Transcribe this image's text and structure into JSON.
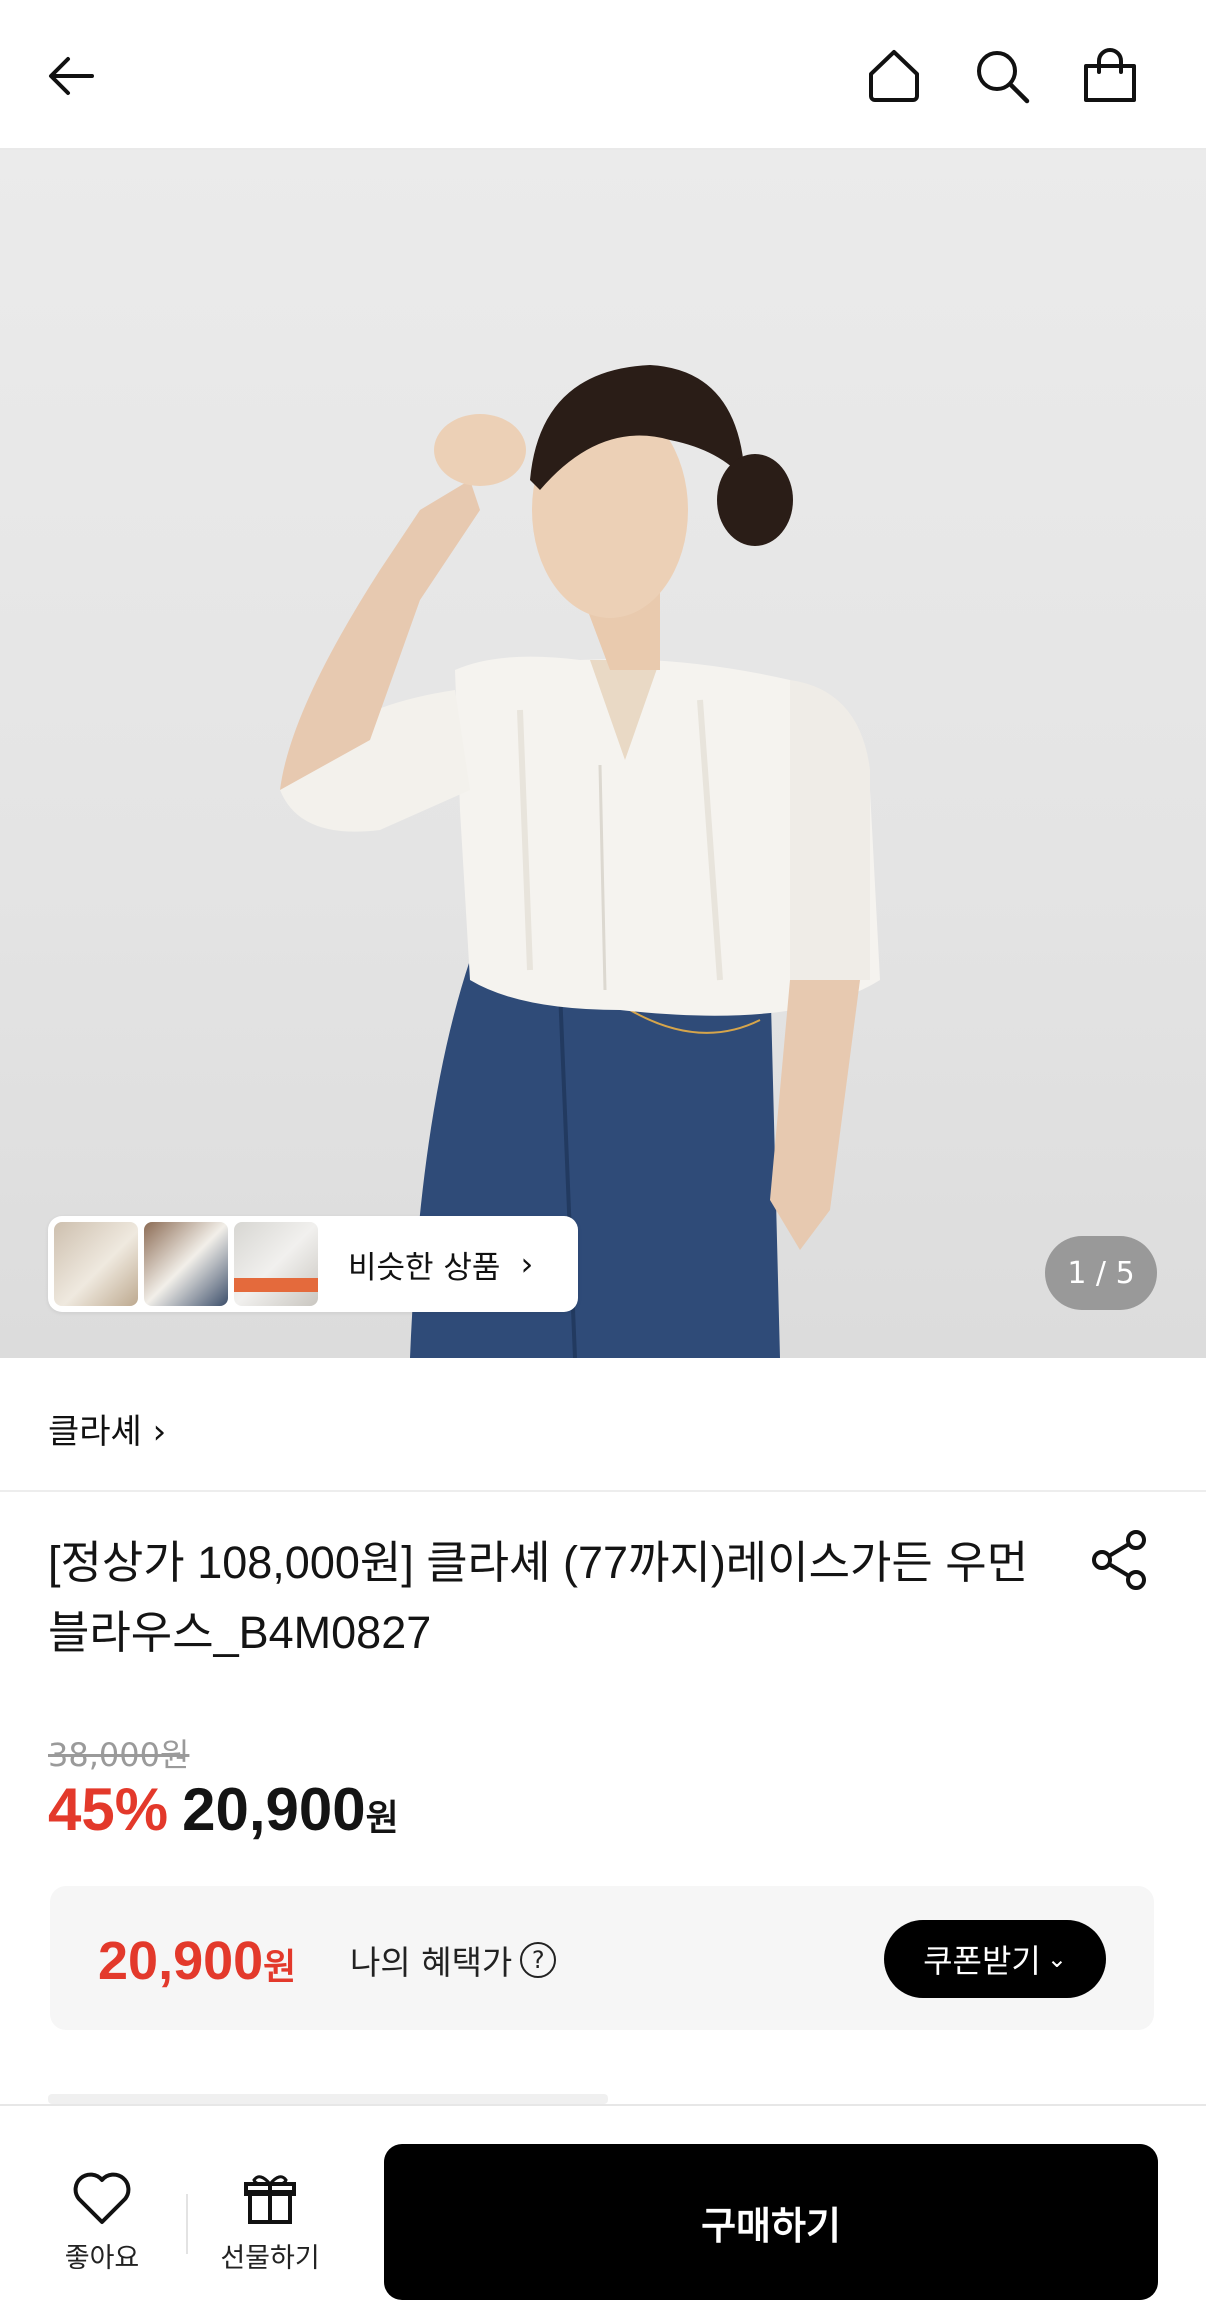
{
  "nav": {
    "back_icon": "arrow-left-icon",
    "home_icon": "home-icon",
    "search_icon": "search-icon",
    "cart_icon": "shopping-bag-icon"
  },
  "hero": {
    "similar_label": "비슷한 상품",
    "similar_chevron": "›",
    "pager": "1 / 5"
  },
  "brand": {
    "name": "클라셰 ›"
  },
  "product": {
    "title": "[정상가 108,000원] 클라셰 (77까지)레이스가든 우먼블라우스_B4M0827",
    "original_price": "38,000원",
    "discount": "45%",
    "sale_price": "20,900",
    "sale_currency": "원"
  },
  "benefit": {
    "price": "20,900",
    "currency": "원",
    "label": "나의 혜택가",
    "help": "?",
    "coupon_button": "쿠폰받기",
    "coupon_chevron": "⌄"
  },
  "bottom": {
    "like_label": "좋아요",
    "gift_label": "선물하기",
    "buy_label": "구매하기"
  },
  "colors": {
    "accent_red": "#e3392b",
    "button_black": "#000000"
  }
}
